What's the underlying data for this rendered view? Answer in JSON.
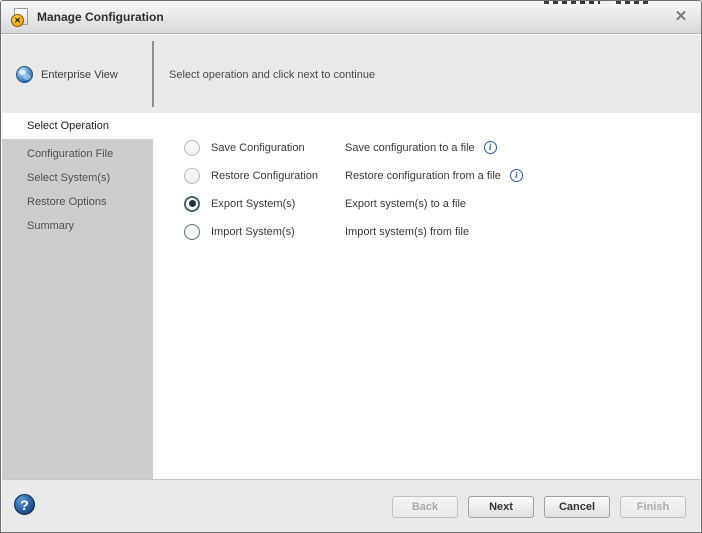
{
  "window": {
    "title": "Manage Configuration"
  },
  "icons": {
    "close_glyph": "✕",
    "badge_glyph": "✕",
    "help_glyph": "?",
    "info_glyph": "i"
  },
  "header": {
    "enterprise_label": "Enterprise View",
    "instruction": "Select operation and click next to continue"
  },
  "sidebar": {
    "items": [
      {
        "label": "Select Operation",
        "active": true
      },
      {
        "label": "Configuration File",
        "active": false
      },
      {
        "label": "Select System(s)",
        "active": false
      },
      {
        "label": "Restore Options",
        "active": false
      },
      {
        "label": "Summary",
        "active": false
      }
    ]
  },
  "options": [
    {
      "label": "Save Configuration",
      "description": "Save configuration to a file",
      "selected": false,
      "has_info": true
    },
    {
      "label": "Restore Configuration",
      "description": "Restore configuration from a file",
      "selected": false,
      "has_info": true
    },
    {
      "label": "Export System(s)",
      "description": "Export system(s) to a file",
      "selected": true,
      "has_info": false
    },
    {
      "label": "Import System(s)",
      "description": "Import system(s) from file",
      "selected": false,
      "has_info": false
    }
  ],
  "footer": {
    "buttons": [
      {
        "label": "Back",
        "enabled": false
      },
      {
        "label": "Next",
        "enabled": true
      },
      {
        "label": "Cancel",
        "enabled": true
      },
      {
        "label": "Finish",
        "enabled": false
      }
    ]
  },
  "colors": {
    "sidebar_bg": "#cdcdcd",
    "band_bg": "#eaeaea",
    "accent_blue": "#2b57a5",
    "radio_dark": "#44606e",
    "help_blue": "#2a65a8"
  }
}
